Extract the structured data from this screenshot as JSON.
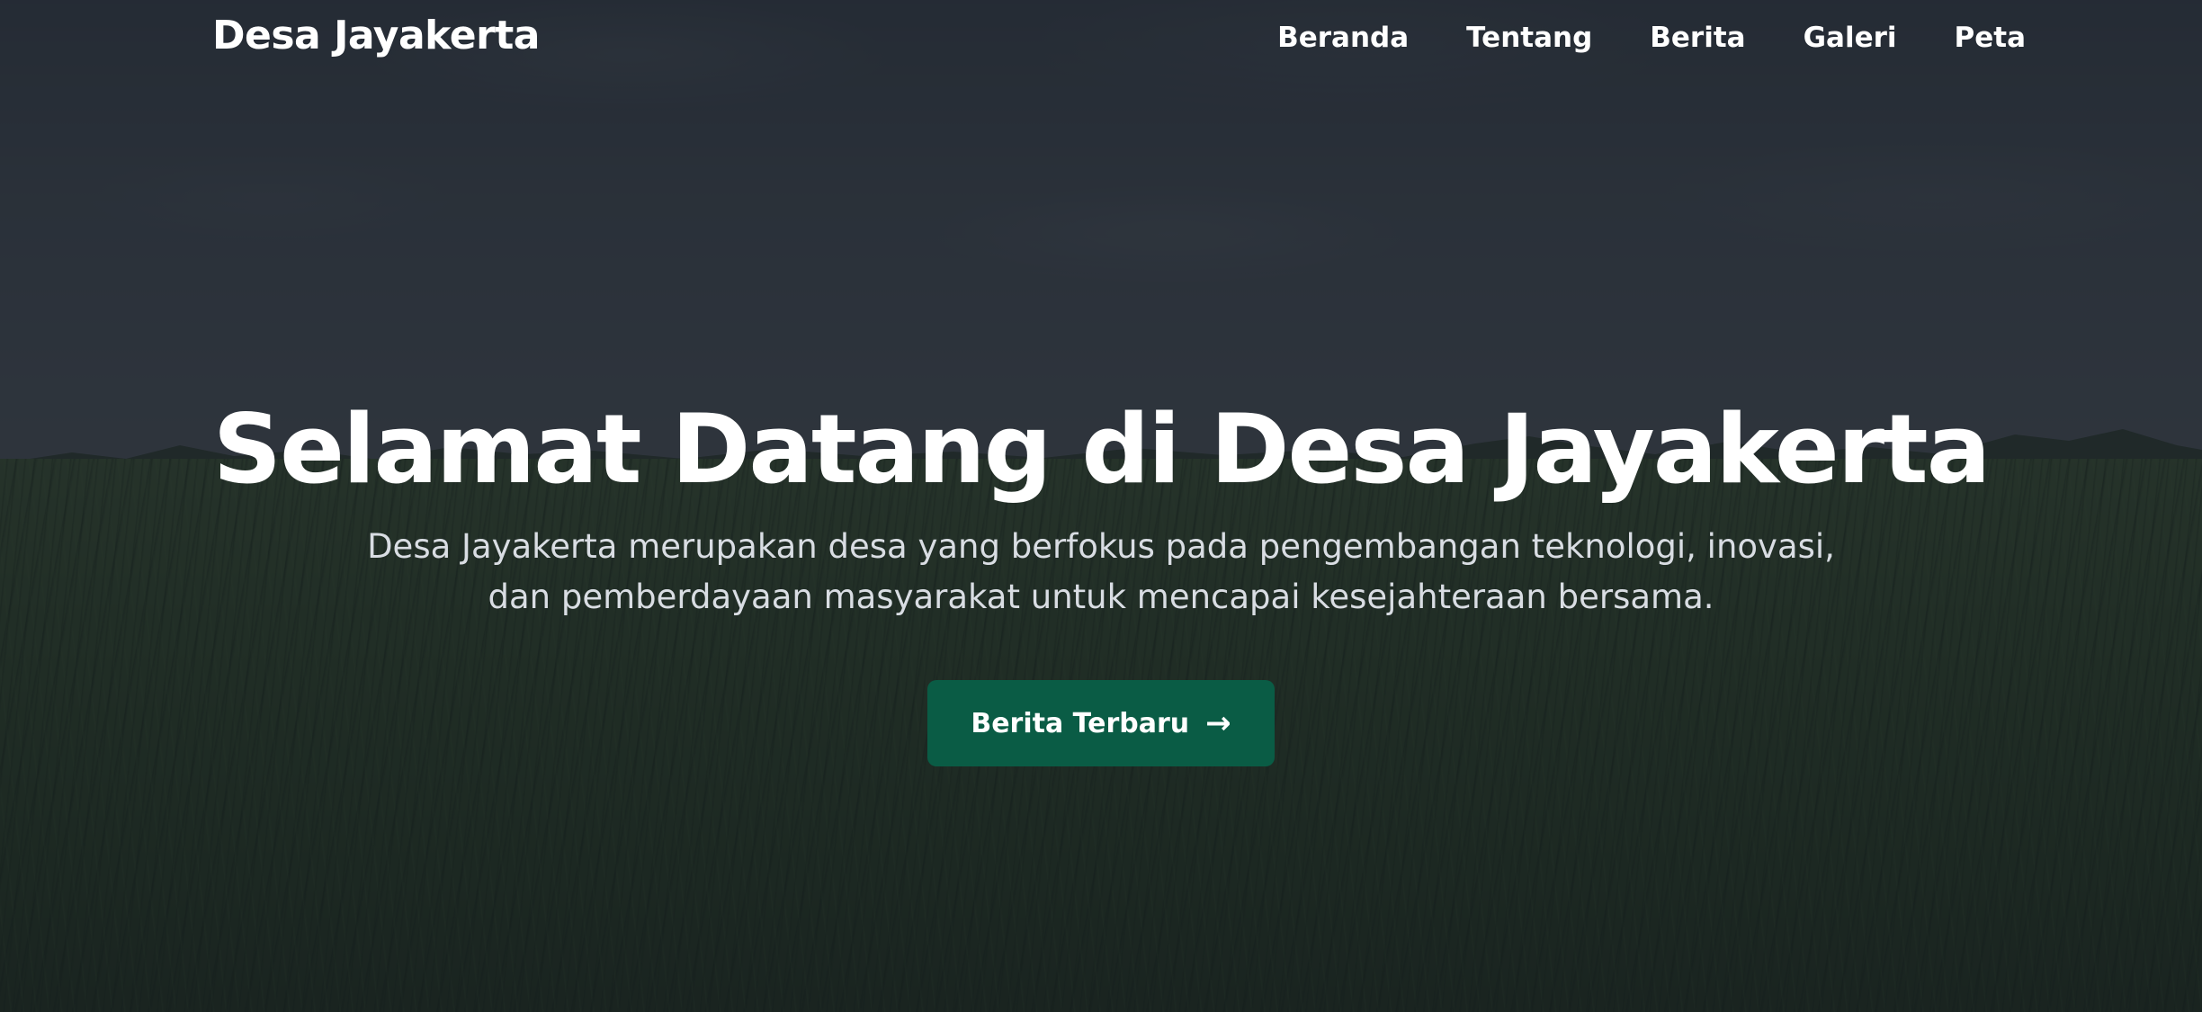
{
  "navbar": {
    "brand": "Desa Jayakerta",
    "links": [
      "Beranda",
      "Tentang",
      "Berita",
      "Galeri",
      "Peta"
    ]
  },
  "hero": {
    "title": "Selamat Datang di Desa Jayakerta",
    "subtitle": "Desa Jayakerta merupakan desa yang berfokus pada pengembangan teknologi, inovasi, dan pemberdayaan masyarakat untuk mencapai kesejahteraan bersama.",
    "cta_label": "Berita Terbaru",
    "cta_icon": "arrow-right-icon",
    "background": "rice-field-photo"
  },
  "colors": {
    "accent": "#0a5c45",
    "overlay": "#161b22",
    "text": "#ffffff"
  }
}
